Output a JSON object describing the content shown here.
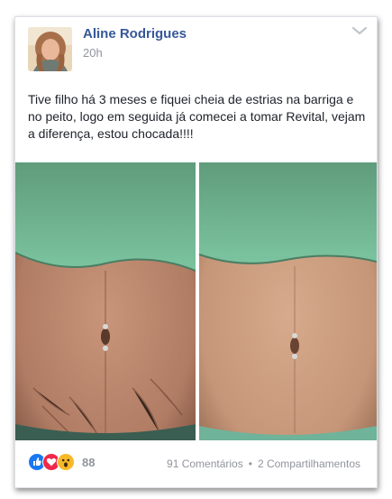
{
  "post": {
    "author": "Aline Rodrigues",
    "time": "20h",
    "text": "Tive filho há 3 meses e fiquei cheia de estrias na barriga e no peito, logo em seguida já comecei a tomar Revital, vejam a diferença, estou chocada!!!!",
    "reaction_count": "88",
    "comments": "91 Comentários",
    "separator": "•",
    "shares": "2 Compartilhamentos"
  },
  "icons": {
    "like": "like-icon",
    "love": "love-icon",
    "wow": "wow-icon",
    "menu": "chevron-down-icon"
  },
  "colors": {
    "name": "#365899",
    "meta": "#90949c",
    "text": "#1d2129",
    "like": "#1877f2",
    "love": "#f0284a",
    "wow": "#f7b928"
  }
}
